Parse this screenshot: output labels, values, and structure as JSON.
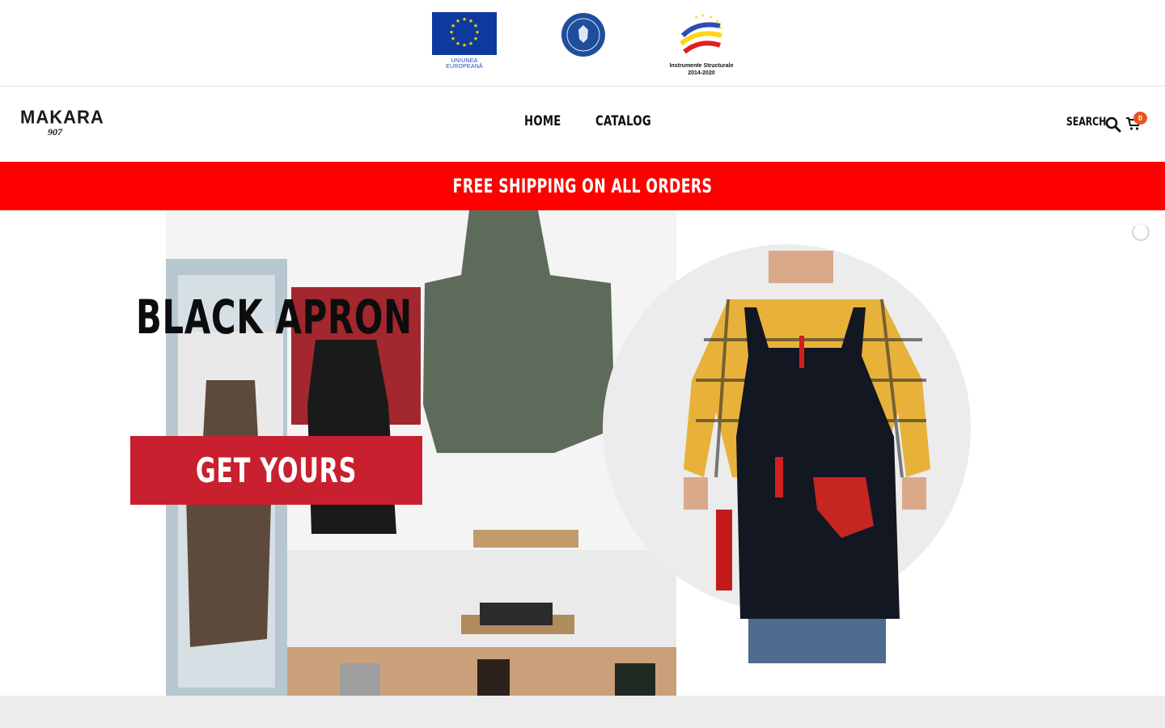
{
  "funding_logos": {
    "eu_caption": "UNIUNEA EUROPEANĂ",
    "gov_text": "GUVERNUL ROMÂNIEI",
    "instruments_caption_line1": "Instrumente Structurale",
    "instruments_caption_line2": "2014-2020"
  },
  "header": {
    "logo_word": "MAKARA",
    "logo_number": "907",
    "nav": [
      {
        "label": "HOME"
      },
      {
        "label": "CATALOG"
      }
    ],
    "search_label": "SEARCH",
    "cart_count": "0"
  },
  "promo": {
    "text": "FREE SHIPPING ON ALL ORDERS"
  },
  "hero": {
    "title": "BLACK APRON",
    "cta_label": "GET YOURS"
  },
  "colors": {
    "promo_bg": "#fe0000",
    "cta_bg": "#c8202f",
    "badge_bg": "#e8541e",
    "eu_blue": "#0d3a9c",
    "eu_star": "#ffd617"
  }
}
